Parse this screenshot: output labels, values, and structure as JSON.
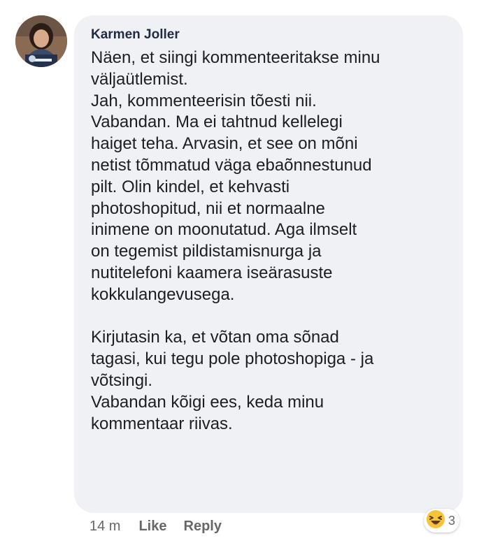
{
  "comment": {
    "author": "Karmen Joller",
    "lines": [
      "Näen, et siingi kommenteeritakse minu",
      "väljaütlemist.",
      "Jah, kommenteerisin tõesti nii.",
      "Vabandan. Ma ei tahtnud kellelegi",
      "haiget teha. Arvasin, et see on mõni",
      "netist tõmmatud väga ebaõnnestunud",
      "pilt. Olin kindel, et kehvasti",
      "photoshopitud, nii et normaalne",
      "inimene on moonutatud. Aga ilmselt",
      "on tegemist pildistamisnurga ja",
      "nutitelefoni kaamera iseärasuste",
      "kokkulangevusega.",
      "",
      "Kirjutasin ka, et võtan oma sõnad",
      "tagasi, kui tegu pole photoshopiga - ja",
      "võtsingi.",
      "Vabandan kõigi ees, keda minu",
      "kommentaar riivas."
    ],
    "timestamp": "14 m",
    "like_label": "Like",
    "reply_label": "Reply",
    "reaction": {
      "icon": "laughing-emoji-icon",
      "count": "3"
    }
  },
  "colors": {
    "bubble": "#f0f1f5",
    "author": "#1f2a44",
    "meta": "#65676b",
    "emoji": "#f7c33b"
  }
}
